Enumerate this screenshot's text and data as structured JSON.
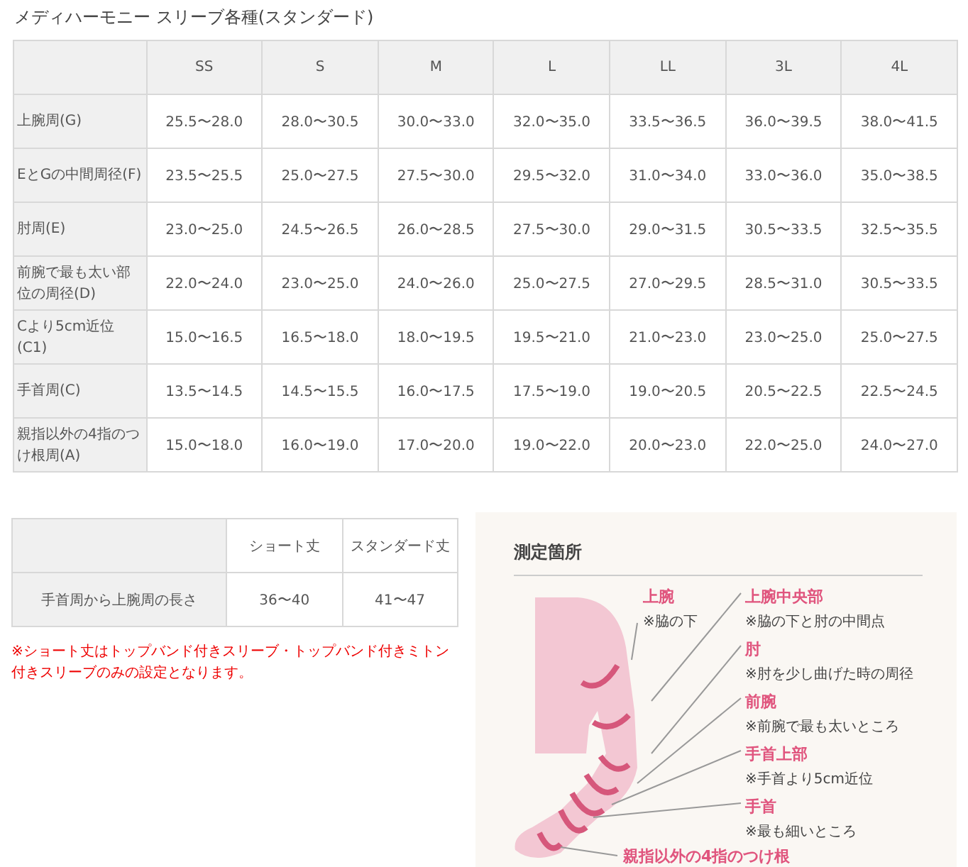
{
  "title": "メディハーモニー スリーブ各種(スタンダード)",
  "size_table": {
    "columns": [
      "SS",
      "S",
      "M",
      "L",
      "LL",
      "3L",
      "4L"
    ],
    "rows": [
      {
        "label": "上腕周(G)",
        "values": [
          "25.5〜28.0",
          "28.0〜30.5",
          "30.0〜33.0",
          "32.0〜35.0",
          "33.5〜36.5",
          "36.0〜39.5",
          "38.0〜41.5"
        ]
      },
      {
        "label": "EとGの中間周径(F)",
        "values": [
          "23.5〜25.5",
          "25.0〜27.5",
          "27.5〜30.0",
          "29.5〜32.0",
          "31.0〜34.0",
          "33.0〜36.0",
          "35.0〜38.5"
        ]
      },
      {
        "label": "肘周(E)",
        "values": [
          "23.0〜25.0",
          "24.5〜26.5",
          "26.0〜28.5",
          "27.5〜30.0",
          "29.0〜31.5",
          "30.5〜33.5",
          "32.5〜35.5"
        ]
      },
      {
        "label": "前腕で最も太い部位の周径(D)",
        "values": [
          "22.0〜24.0",
          "23.0〜25.0",
          "24.0〜26.0",
          "25.0〜27.5",
          "27.0〜29.5",
          "28.5〜31.0",
          "30.5〜33.5"
        ]
      },
      {
        "label": "Cより5cm近位(C1)",
        "values": [
          "15.0〜16.5",
          "16.5〜18.0",
          "18.0〜19.5",
          "19.5〜21.0",
          "21.0〜23.0",
          "23.0〜25.0",
          "25.0〜27.5"
        ]
      },
      {
        "label": "手首周(C)",
        "values": [
          "13.5〜14.5",
          "14.5〜15.5",
          "16.0〜17.5",
          "17.5〜19.0",
          "19.0〜20.5",
          "20.5〜22.5",
          "22.5〜24.5"
        ]
      },
      {
        "label": "親指以外の4指のつけ根周(A)",
        "values": [
          "15.0〜18.0",
          "16.0〜19.0",
          "17.0〜20.0",
          "19.0〜22.0",
          "20.0〜23.0",
          "22.0〜25.0",
          "24.0〜27.0"
        ]
      }
    ]
  },
  "length_table": {
    "columns": [
      "ショート丈",
      "スタンダード丈"
    ],
    "rows": [
      {
        "label": "手首周から上腕周の長さ",
        "values": [
          "36〜40",
          "41〜47"
        ]
      }
    ]
  },
  "note": "※ショート丈はトップバンド付きスリーブ・トップバンド付きミトン付きスリーブのみの設定となります。",
  "diagram": {
    "title": "測定箇所",
    "points": [
      {
        "name": "上腕",
        "note": "※脇の下"
      },
      {
        "name": "上腕中央部",
        "note": "※脇の下と肘の中間点"
      },
      {
        "name": "肘",
        "note": "※肘を少し曲げた時の周径"
      },
      {
        "name": "前腕",
        "note": "※前腕で最も太いところ"
      },
      {
        "name": "手首上部",
        "note": "※手首より5cm近位"
      },
      {
        "name": "手首",
        "note": "※最も細いところ"
      }
    ],
    "base_label": "親指以外の4指のつけ根"
  }
}
